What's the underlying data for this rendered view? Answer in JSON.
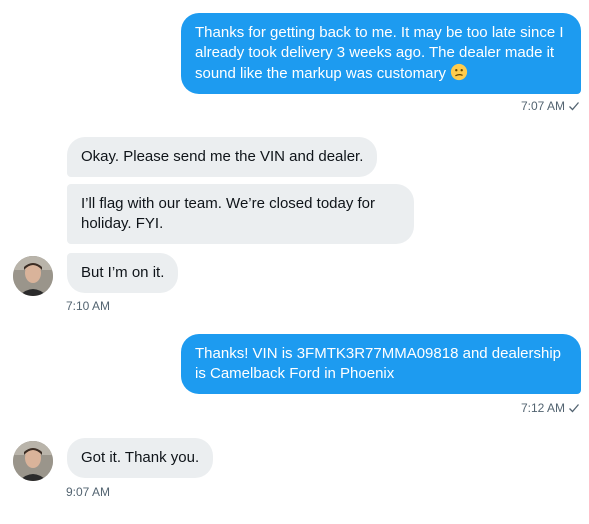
{
  "messages": [
    {
      "text": "Thanks for getting back to me. It may be too late since I already took delivery 3 weeks ago. The dealer made it sound like the markup was customary",
      "time": "7:07 AM"
    },
    {
      "text": "Okay. Please send me the VIN and dealer."
    },
    {
      "text": "I’ll flag with our team. We’re closed today for holiday. FYI."
    },
    {
      "text": "But I’m on it.",
      "time": "7:10 AM"
    },
    {
      "text": "Thanks! VIN is 3FMTK3R77MMA09818 and dealership is Camelback Ford in Phoenix",
      "time": "7:12 AM"
    },
    {
      "text": "Got it. Thank you.",
      "time": "9:07 AM"
    }
  ],
  "icons": {
    "emoji": "confused-face-emoji",
    "read_receipt": "checkmark-icon",
    "avatar": "user-avatar"
  },
  "colors": {
    "outgoing_bubble": "#1d9bf0",
    "incoming_bubble": "#ebeef0",
    "timestamp": "#536471"
  }
}
